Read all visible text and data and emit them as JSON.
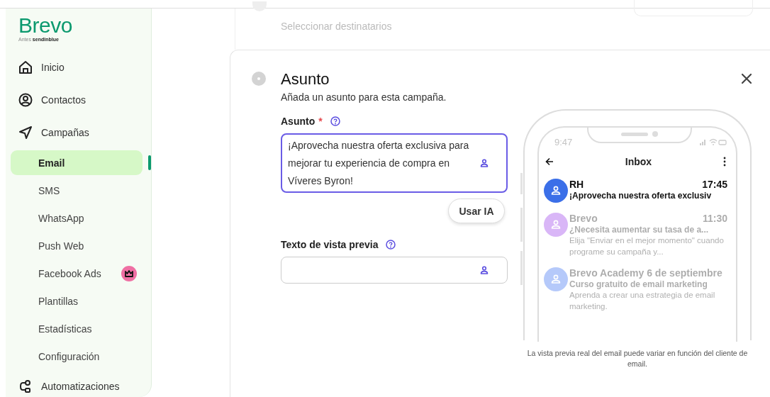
{
  "logo": {
    "name": "Brevo",
    "formerly_label": "Antes",
    "formerly_name": "sendinblue"
  },
  "sidebar": {
    "items": [
      {
        "label": "Inicio",
        "kind": "home",
        "selected": false
      },
      {
        "label": "Contactos",
        "kind": "contact",
        "selected": false
      },
      {
        "label": "Campañas",
        "kind": "send",
        "selected": false,
        "children": [
          {
            "label": "Email",
            "selected": true
          },
          {
            "label": "SMS",
            "selected": false
          },
          {
            "label": "WhatsApp",
            "selected": false
          },
          {
            "label": "Push Web",
            "selected": false
          },
          {
            "label": "Facebook Ads",
            "selected": false,
            "premium": true
          },
          {
            "label": "Plantillas",
            "selected": false
          },
          {
            "label": "Estadísticas",
            "selected": false
          },
          {
            "label": "Configuración",
            "selected": false
          }
        ]
      },
      {
        "label": "Automatizaciones",
        "kind": "automation",
        "selected": false
      }
    ]
  },
  "previous_step": {
    "subtitle": "Seleccionar destinatarios"
  },
  "step": {
    "title": "Asunto",
    "subtitle": "Añada un asunto para esta campaña.",
    "subject": {
      "label": "Asunto",
      "required_mark": "*",
      "value": "¡Aprovecha nuestra oferta exclusiva para mejorar tu experiencia de compra en Víveres Byron!"
    },
    "ai_button": "Usar IA",
    "preview_text": {
      "label": "Texto de vista previa"
    }
  },
  "phone": {
    "time": "9:47",
    "title": "Inbox",
    "emails": [
      {
        "sender": "RH",
        "time": "17:45",
        "subject": "¡Aprovecha nuestra oferta exclusiv",
        "color": "#3b6fe8",
        "dimmed": false
      },
      {
        "sender": "Brevo",
        "time": "11:30",
        "subject": "¿Necesita aumentar su tasa de a...",
        "preview": "Elija \"Enviar en el mejor momento\" cuando programe su campaña y...",
        "color": "#d9b6f7",
        "dimmed": true
      },
      {
        "sender": "Brevo Academy 6 de septiembre",
        "subject": "Curso gratuito de email marketing",
        "preview": "Aprenda a crear una estrategia de email marketing.",
        "color": "#b5c9fa",
        "dimmed": true
      }
    ],
    "caption": "La vista previa real del email puede variar en función del cliente de email."
  }
}
